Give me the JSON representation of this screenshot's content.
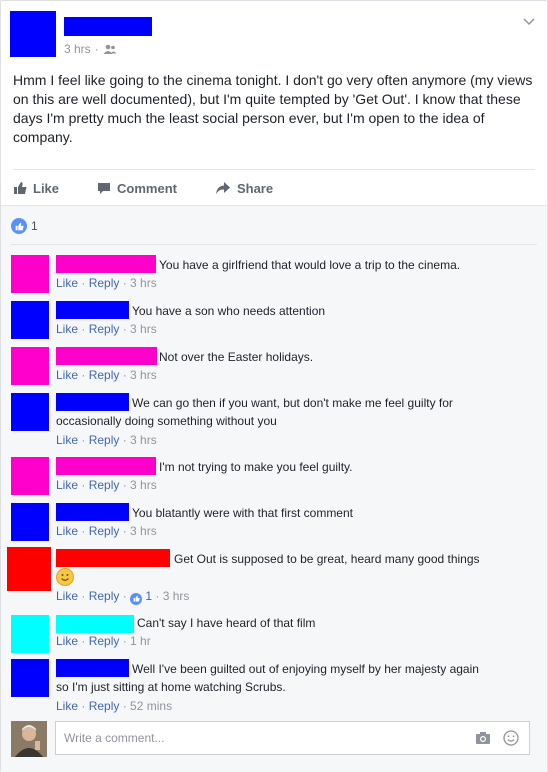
{
  "post": {
    "time": "3 hrs",
    "audience_icon": "friends-icon",
    "text": "Hmm I feel like going to the cinema tonight. I don't go very often anymore (my views on this are well documented), but I'm quite tempted by 'Get Out'. I know that these days I'm pretty much the least social person ever, but I'm open to the idea of company."
  },
  "actions": {
    "like": "Like",
    "comment": "Comment",
    "share": "Share"
  },
  "reactions": {
    "count": "1"
  },
  "comment_labels": {
    "like": "Like",
    "reply": "Reply"
  },
  "comments": [
    {
      "color": "#ff00cc",
      "text": "You have a girlfriend that would love a trip to the cinema.",
      "time": "3 hrs"
    },
    {
      "color": "#0000ff",
      "text": "You have a son who needs attention",
      "time": "3 hrs"
    },
    {
      "color": "#ff00cc",
      "text": "Not over the Easter holidays.",
      "time": "3 hrs"
    },
    {
      "color": "#0000ff",
      "text1": "We can go then if you want, but don't make me feel guilty for",
      "text2": "occasionally doing something without you",
      "time": "3 hrs"
    },
    {
      "color": "#ff00cc",
      "text": "I'm not trying to make you feel guilty.",
      "time": "3 hrs"
    },
    {
      "color": "#0000ff",
      "text": "You blatantly were with that first comment",
      "time": "3 hrs"
    },
    {
      "color": "#ff0000",
      "text": "Get Out is supposed to be great, heard many good things",
      "likes": "1",
      "time": "3 hrs"
    },
    {
      "color": "#00ffff",
      "text": "Can't say I have heard of that film",
      "time": "1 hr"
    },
    {
      "color": "#0000ff",
      "text1": "Well I've been guilted out of enjoying myself by her majesty again",
      "text2": "so I'm just sitting at home watching Scrubs.",
      "time": "52 mins"
    }
  ],
  "composer": {
    "placeholder": "Write a comment..."
  }
}
